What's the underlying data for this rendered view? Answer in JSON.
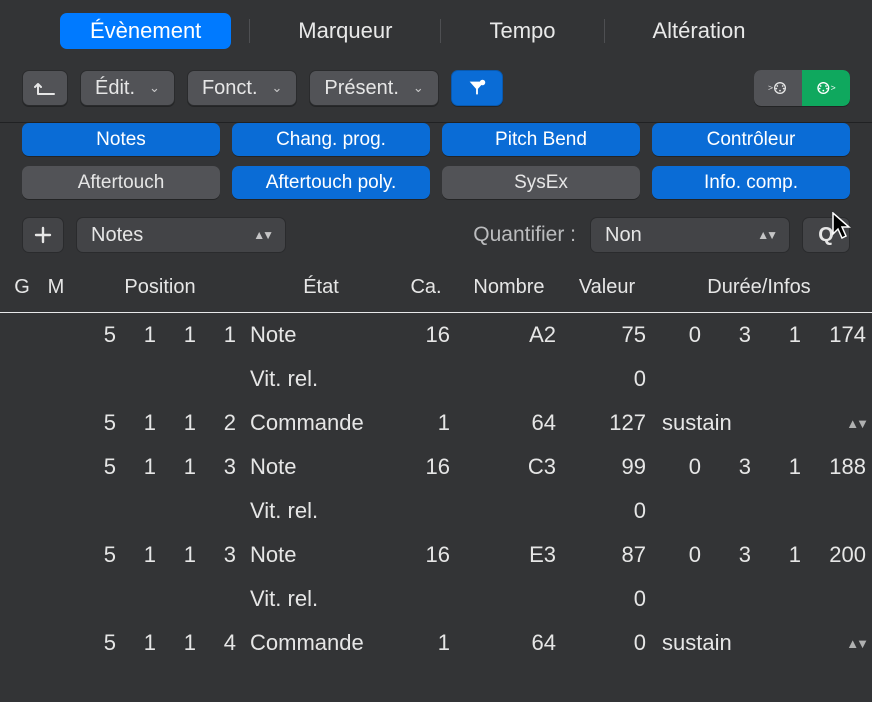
{
  "tabs": {
    "event": "Évènement",
    "marker": "Marqueur",
    "tempo": "Tempo",
    "signature": "Altération"
  },
  "toolbar": {
    "edit": "Édit.",
    "functions": "Fonct.",
    "view": "Présent."
  },
  "filters": {
    "notes": "Notes",
    "prog_change": "Chang. prog.",
    "pitch_bend": "Pitch Bend",
    "controller": "Contrôleur",
    "aftertouch": "Aftertouch",
    "poly_aftertouch": "Aftertouch poly.",
    "sysex": "SysEx",
    "meta": "Info. comp."
  },
  "insert": {
    "type_value": "Notes"
  },
  "quantize": {
    "label": "Quantifier :",
    "value": "Non",
    "button": "Q"
  },
  "columns": {
    "g": "G",
    "m": "M",
    "position": "Position",
    "status": "État",
    "ch": "Ca.",
    "num": "Nombre",
    "val": "Valeur",
    "len": "Durée/Infos"
  },
  "rows": [
    {
      "pos": [
        "5",
        "1",
        "1",
        "1"
      ],
      "status": "Note",
      "ch": "16",
      "num": "A2",
      "val": "75",
      "len": [
        "0",
        "3",
        "1",
        "174"
      ]
    },
    {
      "pos": [
        "",
        "",
        "",
        ""
      ],
      "status": "Vit. rel.",
      "ch": "",
      "num": "",
      "val": "0",
      "len": null
    },
    {
      "pos": [
        "5",
        "1",
        "1",
        "2"
      ],
      "status": "Commande",
      "ch": "1",
      "num": "64",
      "val": "127",
      "sustain": "sustain"
    },
    {
      "pos": [
        "5",
        "1",
        "1",
        "3"
      ],
      "status": "Note",
      "ch": "16",
      "num": "C3",
      "val": "99",
      "len": [
        "0",
        "3",
        "1",
        "188"
      ]
    },
    {
      "pos": [
        "",
        "",
        "",
        ""
      ],
      "status": "Vit. rel.",
      "ch": "",
      "num": "",
      "val": "0",
      "len": null
    },
    {
      "pos": [
        "5",
        "1",
        "1",
        "3"
      ],
      "status": "Note",
      "ch": "16",
      "num": "E3",
      "val": "87",
      "len": [
        "0",
        "3",
        "1",
        "200"
      ]
    },
    {
      "pos": [
        "",
        "",
        "",
        ""
      ],
      "status": "Vit. rel.",
      "ch": "",
      "num": "",
      "val": "0",
      "len": null
    },
    {
      "pos": [
        "5",
        "1",
        "1",
        "4"
      ],
      "status": "Commande",
      "ch": "1",
      "num": "64",
      "val": "0",
      "sustain": "sustain"
    }
  ]
}
